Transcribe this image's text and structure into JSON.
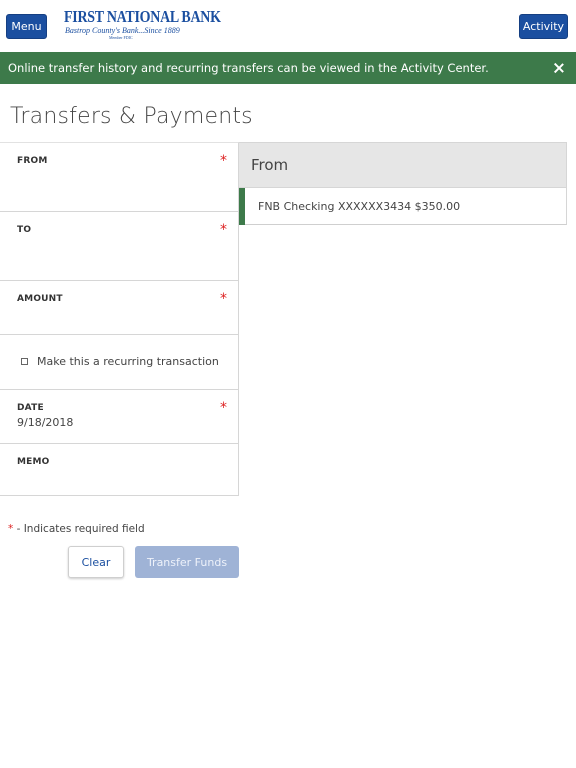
{
  "header": {
    "menu_label": "Menu",
    "activity_label": "Activity",
    "logo": {
      "name": "First National Bank",
      "tagline": "Bastrop County's Bank...Since 1889",
      "fdic": "Member FDIC"
    }
  },
  "banner": {
    "message": "Online transfer history and recurring transfers can be viewed in the Activity Center."
  },
  "page": {
    "title": "Transfers & Payments"
  },
  "form": {
    "from_label": "FROM",
    "to_label": "TO",
    "amount_label": "AMOUNT",
    "recurring_label": "Make this a recurring transaction",
    "date_label": "DATE",
    "date_value": "9/18/2018",
    "memo_label": "MEMO",
    "required_marker": "*",
    "required_note": " - Indicates required field"
  },
  "buttons": {
    "clear": "Clear",
    "transfer": "Transfer Funds"
  },
  "panel": {
    "heading": "From",
    "accounts": [
      "FNB Checking XXXXXX3434 $350.00"
    ]
  },
  "colors": {
    "brand_blue": "#1b4fa0",
    "banner_green": "#3d7a4a",
    "required_red": "#dd2222",
    "disabled_blue": "#9fb3d6"
  }
}
